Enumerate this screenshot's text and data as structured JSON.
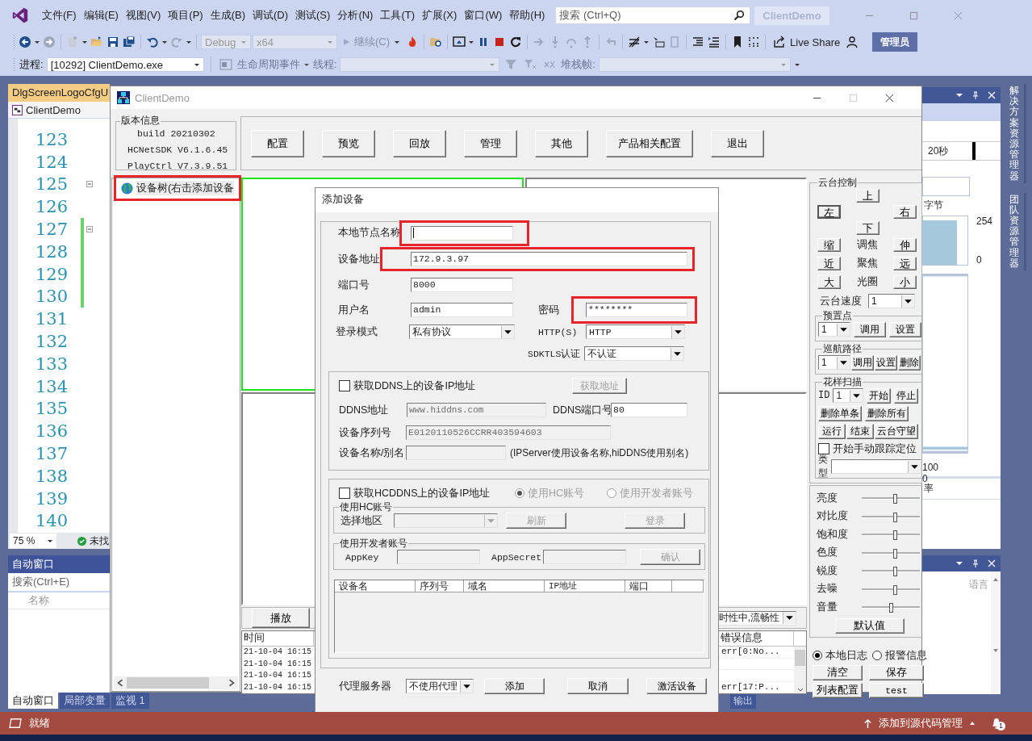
{
  "menu": [
    "文件(F)",
    "编辑(E)",
    "视图(V)",
    "项目(P)",
    "生成(B)",
    "调试(D)",
    "测试(S)",
    "分析(N)",
    "工具(T)",
    "扩展(X)",
    "窗口(W)",
    "帮助(H)"
  ],
  "search": {
    "placeholder": "搜索 (Ctrl+Q)"
  },
  "solution_name": "ClientDemo",
  "toolbar": {
    "config": "Debug",
    "platform": "x64",
    "continue": "继续(C)",
    "live_share": "Live Share",
    "admin": "管理员"
  },
  "debug_bar": {
    "process_label": "进程:",
    "process": "[10292] ClientDemo.exe",
    "lifecycle": "生命周期事件",
    "thread_label": "线程:",
    "stack_label": "堆栈帧:"
  },
  "editor": {
    "tab": "DlgScreenLogoCfgU",
    "nav": "ClientDemo",
    "zoom": "75 %",
    "status": "未找",
    "lines": [
      {
        "n": "123",
        "modified": false,
        "foldable": false
      },
      {
        "n": "124",
        "modified": false,
        "foldable": false
      },
      {
        "n": "125",
        "modified": false,
        "foldable": true
      },
      {
        "n": "126",
        "modified": false,
        "foldable": false
      },
      {
        "n": "127",
        "modified": true,
        "foldable": true
      },
      {
        "n": "128",
        "modified": true,
        "foldable": false
      },
      {
        "n": "129",
        "modified": true,
        "foldable": false
      },
      {
        "n": "130",
        "modified": true,
        "foldable": false
      },
      {
        "n": "131",
        "modified": false,
        "foldable": false
      },
      {
        "n": "132",
        "modified": false,
        "foldable": false
      },
      {
        "n": "133",
        "modified": false,
        "foldable": false
      },
      {
        "n": "134",
        "modified": false,
        "foldable": false
      },
      {
        "n": "135",
        "modified": false,
        "foldable": false
      },
      {
        "n": "136",
        "modified": false,
        "foldable": false
      },
      {
        "n": "137",
        "modified": false,
        "foldable": false
      },
      {
        "n": "138",
        "modified": false,
        "foldable": false
      },
      {
        "n": "139",
        "modified": false,
        "foldable": false
      },
      {
        "n": "140",
        "modified": false,
        "foldable": false
      }
    ]
  },
  "autos": {
    "title": "自动窗口",
    "search": "搜索(Ctrl+E)",
    "column": "名称",
    "tabs": [
      {
        "label": "自动窗口",
        "selected": true
      },
      {
        "label": "局部变量",
        "selected": false
      },
      {
        "label": "监视 1",
        "selected": false
      }
    ]
  },
  "diagnostics": {
    "time": "20秒",
    "unit": "字节",
    "mem_max": "254",
    "mem_min": "0",
    "cpu_max": "100",
    "cpu_min": "0",
    "rate": "率"
  },
  "lower_panel": {
    "column": "语言",
    "tab": "输出"
  },
  "side_tabs": [
    "解决方案资源管理器",
    "团队资源管理器"
  ],
  "client": {
    "title": "ClientDemo",
    "version": {
      "title": "版本信息",
      "lines": [
        "build 20210302",
        "HCNetSDK V6.1.6.45",
        "PlayCtrl V7.3.9.51"
      ]
    },
    "buttons": [
      "配置",
      "预览",
      "回放",
      "管理",
      "其他",
      "产品相关配置",
      "退出"
    ],
    "tree": {
      "root": "设备树(右击添加设备",
      "highlighted": true
    },
    "panes": [
      {
        "selected": true
      },
      {
        "selected": false
      },
      {
        "selected": false
      },
      {
        "selected": false
      }
    ],
    "play_button": "播放",
    "stream_mode": "时性中,流畅性",
    "log": {
      "time_column": "时间",
      "error_column": "错误信息",
      "rows": [
        {
          "time": "21-10-04 16:15",
          "error": "err[0:No..."
        },
        {
          "time": "21-10-04 16:15",
          "error": ""
        },
        {
          "time": "21-10-04 16:15",
          "error": ""
        },
        {
          "time": "21-10-04 16:15",
          "error": "err[17:P..."
        }
      ]
    },
    "ptz": {
      "title": "云台控制",
      "up": "上",
      "left": "左",
      "right": "右",
      "down": "下",
      "rows": [
        {
          "minus": "缩",
          "label": "调焦",
          "plus": "伸"
        },
        {
          "minus": "近",
          "label": "聚焦",
          "plus": "远"
        },
        {
          "minus": "大",
          "label": "光圈",
          "plus": "小"
        }
      ],
      "speed_label": "云台速度",
      "speed": "1",
      "preset": {
        "title": "预置点",
        "value": "1",
        "buttons": [
          "调用",
          "设置"
        ]
      },
      "cruise": {
        "title": "巡航路径",
        "value": "1",
        "buttons": [
          "调用",
          "设置",
          "删除"
        ]
      },
      "pattern": {
        "title": "花样扫描",
        "id_label": "ID",
        "value": "1",
        "row1": [
          "开始",
          "停止"
        ],
        "row2": [
          "删除单条",
          "删除所有"
        ],
        "row3": [
          "运行",
          "结束",
          "云台守望"
        ]
      },
      "track": {
        "label": "开始手动跟踪定位",
        "checked": false
      },
      "type_label": "类型"
    },
    "sliders": [
      {
        "label": "亮度",
        "level": 0.57
      },
      {
        "label": "对比度",
        "level": 0.57
      },
      {
        "label": "饱和度",
        "level": 0.57
      },
      {
        "label": "色度",
        "level": 0.57
      },
      {
        "label": "锐度",
        "level": 0.57
      },
      {
        "label": "去噪",
        "level": 0.57
      },
      {
        "label": "音量",
        "level": 0.5
      }
    ],
    "default_button": "默认值",
    "log_types": [
      {
        "label": "本地日志",
        "selected": true
      },
      {
        "label": "报警信息",
        "selected": false
      }
    ],
    "log_buttons": [
      "清空",
      "保存",
      "列表配置",
      "test"
    ]
  },
  "dialog": {
    "title": "添加设备",
    "node_name": {
      "label": "本地节点名称",
      "highlighted": true
    },
    "address": {
      "label": "设备地址",
      "value": "172.9.3.97",
      "highlighted": true
    },
    "port": {
      "label": "端口号",
      "value": "8000"
    },
    "username": {
      "label": "用户名",
      "value": "admin"
    },
    "password": {
      "label": "密码",
      "value": "********",
      "highlighted": true
    },
    "login_mode": {
      "label": "登录模式",
      "value": "私有协议"
    },
    "http": {
      "label": "HTTP(S)",
      "value": "HTTP"
    },
    "tls": {
      "label": "SDKTLS认证",
      "value": "不认证"
    },
    "ddns": {
      "checkbox": {
        "label": "获取DDNS上的设备IP地址",
        "checked": false
      },
      "fetch": {
        "label": "获取地址",
        "disabled": true
      },
      "address": {
        "label": "DDNS地址",
        "value": "www.hiddns.com",
        "disabled": true
      },
      "port": {
        "label": "DDNS端口号",
        "value": "80",
        "disabled": false
      },
      "serial": {
        "label": "设备序列号",
        "value": "E0120110526CCRR403594603",
        "disabled": true
      },
      "alias": {
        "label": "设备名称/别名",
        "disabled": true
      },
      "note": "(IPServer使用设备名称,hiDDNS使用别名)"
    },
    "hcddns": {
      "checkbox": {
        "label": "获取HCDDNS上的设备IP地址",
        "checked": false
      },
      "account_types": [
        {
          "label": "使用HC账号",
          "selected": true,
          "disabled": true
        },
        {
          "label": "使用开发者账号",
          "selected": false,
          "disabled": true
        }
      ],
      "hc": {
        "title": "使用HC账号",
        "region_label": "选择地区",
        "region_disabled": true,
        "refresh": {
          "label": "刷新",
          "disabled": true
        },
        "login": {
          "label": "登录",
          "disabled": true
        }
      },
      "dev": {
        "title": "使用开发者账号",
        "key_label": "AppKey",
        "secret_label": "AppSecret",
        "fields_disabled": true,
        "confirm": {
          "label": "确认",
          "disabled": true
        }
      }
    },
    "list_columns": [
      "设备名",
      "序列号",
      "域名",
      "IP地址",
      "端口"
    ],
    "proxy": {
      "label": "代理服务器",
      "value": "不使用代理"
    },
    "buttons": [
      "添加",
      "取消",
      "激活设备"
    ]
  },
  "status_bar": {
    "text": "就绪",
    "source_control": "添加到源代码管理",
    "notifications": "1"
  }
}
